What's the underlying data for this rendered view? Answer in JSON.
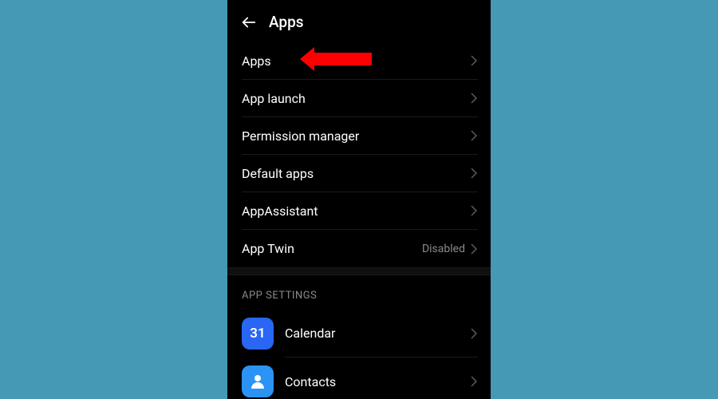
{
  "header": {
    "title": "Apps"
  },
  "menu": {
    "items": [
      {
        "label": "Apps",
        "value": ""
      },
      {
        "label": "App launch",
        "value": ""
      },
      {
        "label": "Permission manager",
        "value": ""
      },
      {
        "label": "Default apps",
        "value": ""
      },
      {
        "label": "AppAssistant",
        "value": ""
      },
      {
        "label": "App Twin",
        "value": "Disabled"
      }
    ]
  },
  "section": {
    "title": "APP SETTINGS"
  },
  "apps": {
    "items": [
      {
        "label": "Calendar",
        "icon_text": "31"
      },
      {
        "label": "Contacts",
        "icon_text": ""
      }
    ]
  }
}
